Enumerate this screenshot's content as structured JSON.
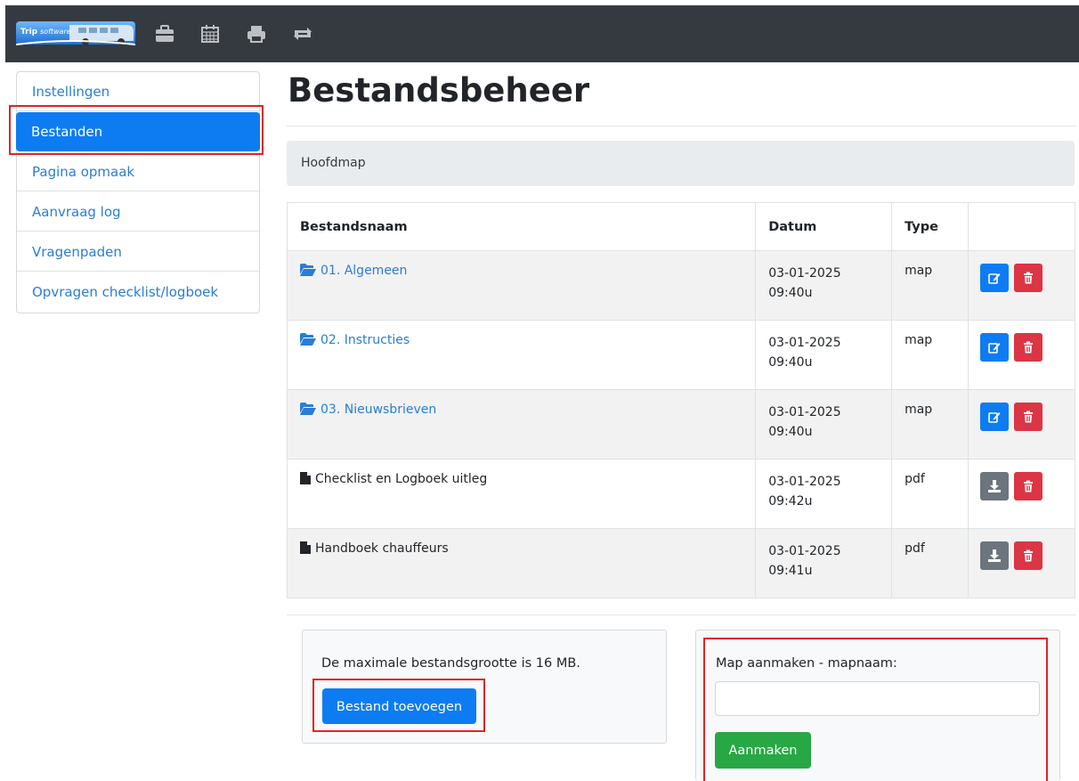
{
  "header": {
    "logo_text": "Trip software",
    "icons": [
      "briefcase-icon",
      "calendar-icon",
      "print-icon",
      "sync-icon"
    ]
  },
  "sidebar": {
    "items": [
      {
        "label": "Instellingen",
        "active": false
      },
      {
        "label": "Bestanden",
        "active": true
      },
      {
        "label": "Pagina opmaak",
        "active": false
      },
      {
        "label": "Aanvraag log",
        "active": false
      },
      {
        "label": "Vragenpaden",
        "active": false
      },
      {
        "label": "Opvragen checklist/logboek",
        "active": false
      }
    ]
  },
  "main": {
    "title": "Bestandsbeheer",
    "breadcrumb": "Hoofdmap",
    "table": {
      "headers": [
        "Bestandsnaam",
        "Datum",
        "Type",
        ""
      ],
      "rows": [
        {
          "name": "01. Algemeen",
          "date": "03-01-2025",
          "time": "09:40u",
          "type": "map",
          "kind": "folder"
        },
        {
          "name": "02. Instructies",
          "date": "03-01-2025",
          "time": "09:40u",
          "type": "map",
          "kind": "folder"
        },
        {
          "name": "03. Nieuwsbrieven",
          "date": "03-01-2025",
          "time": "09:40u",
          "type": "map",
          "kind": "folder"
        },
        {
          "name": "Checklist en Logboek uitleg",
          "date": "03-01-2025",
          "time": "09:42u",
          "type": "pdf",
          "kind": "file"
        },
        {
          "name": "Handboek chauffeurs",
          "date": "03-01-2025",
          "time": "09:41u",
          "type": "pdf",
          "kind": "file"
        }
      ]
    },
    "upload": {
      "text": "De maximale bestandsgrootte is 16 MB.",
      "button": "Bestand toevoegen"
    },
    "create_folder": {
      "label": "Map aanmaken - mapnaam:",
      "value": "",
      "placeholder": "",
      "button": "Aanmaken"
    }
  },
  "colors": {
    "topbar": "#343a40",
    "primary": "#0d7cf2",
    "danger": "#dc3545",
    "secondary": "#6c757d",
    "success": "#28a745",
    "highlight": "#e02424"
  }
}
